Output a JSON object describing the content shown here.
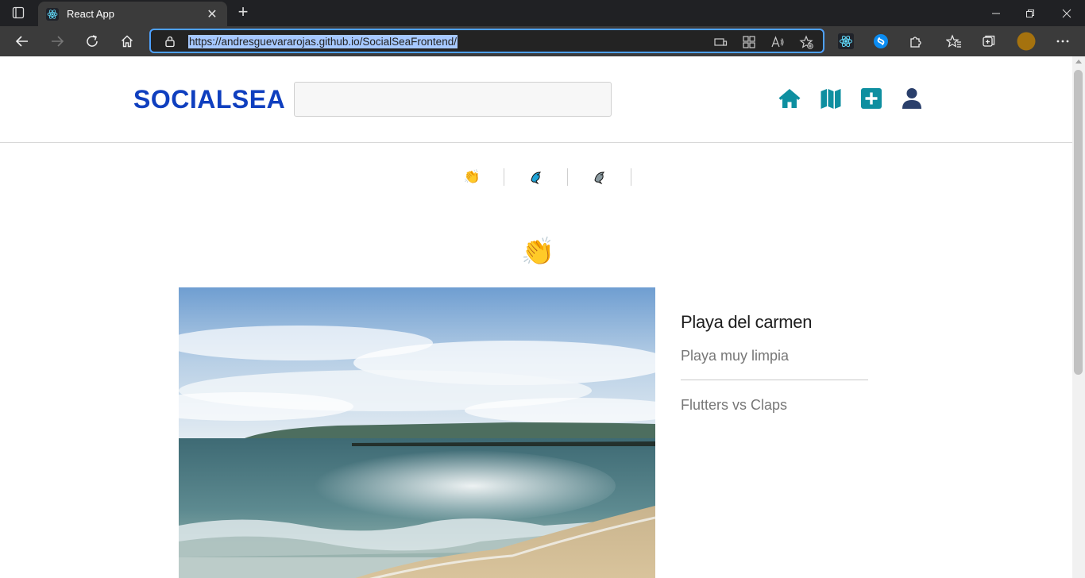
{
  "browser": {
    "tab_title": "React App",
    "url": "https://andresguevararojas.github.io/SocialSeaFrontend/",
    "icons": [
      "tab-actions-icon",
      "react-favicon",
      "close-tab-icon",
      "new-tab-icon",
      "minimize-icon",
      "restore-icon",
      "close-window-icon",
      "back-icon",
      "forward-icon",
      "refresh-icon",
      "home-icon",
      "lock-icon",
      "devices-icon",
      "apps-icon",
      "read-aloud-icon",
      "add-favorite-icon",
      "react-devtools-icon",
      "shazam-icon",
      "extensions-icon",
      "favorites-icon",
      "collections-icon",
      "profile-avatar",
      "more-icon"
    ]
  },
  "header": {
    "logo": "SOCIALSEA",
    "search": {
      "value": "",
      "placeholder": ""
    },
    "nav": [
      "home-icon",
      "map-icon",
      "add-post-icon",
      "profile-icon"
    ],
    "nav_color": "#0e8fa0",
    "profile_color": "#2a3f6b"
  },
  "filters": [
    {
      "emoji": "👏",
      "name": "claps"
    },
    {
      "emoji": "🐬",
      "name": "flutters-blue"
    },
    {
      "emoji": "🐬",
      "name": "flutters-grey"
    }
  ],
  "post": {
    "reaction_emoji": "👏",
    "title": "Playa del carmen",
    "description": "Playa muy limpia",
    "stats_label": "Flutters vs Claps",
    "image": "beach-photo"
  },
  "colors": {
    "logo": "#0f3fbf",
    "chrome_dark": "#202124",
    "chrome_toolbar": "#3b3b3b",
    "address_focus": "#4ea1ff"
  }
}
